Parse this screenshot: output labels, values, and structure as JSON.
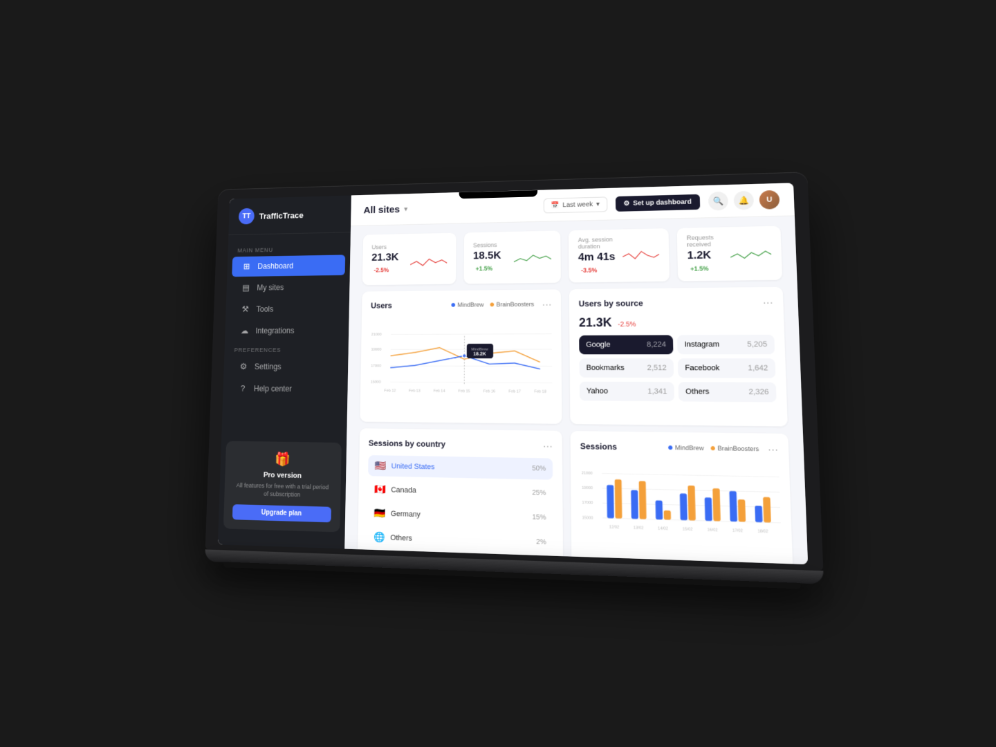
{
  "app": {
    "name": "TrafficTrace"
  },
  "topbar": {
    "title": "All sites",
    "date_filter": "Last week",
    "setup_btn": "Set up dashboard"
  },
  "sidebar": {
    "main_menu_label": "Main menu",
    "preferences_label": "Preferences",
    "items": [
      {
        "id": "dashboard",
        "label": "Dashboard",
        "icon": "⊞",
        "active": true
      },
      {
        "id": "my-sites",
        "label": "My sites",
        "icon": "▤",
        "active": false
      },
      {
        "id": "tools",
        "label": "Tools",
        "icon": "⚒",
        "active": false
      },
      {
        "id": "integrations",
        "label": "Integrations",
        "icon": "☁",
        "active": false
      },
      {
        "id": "settings",
        "label": "Settings",
        "icon": "⚙",
        "active": false
      },
      {
        "id": "help",
        "label": "Help center",
        "icon": "?",
        "active": false
      }
    ],
    "pro": {
      "title": "Pro version",
      "description": "All features for free with a trial period of subscription",
      "upgrade_label": "Upgrade plan"
    }
  },
  "stats": [
    {
      "label": "Users",
      "value": "21.3K",
      "change": "-2.5%",
      "positive": false
    },
    {
      "label": "Sessions",
      "value": "18.5K",
      "change": "+1.5%",
      "positive": true
    },
    {
      "label": "Avg. session duration",
      "value": "4m 41s",
      "change": "-3.5%",
      "positive": false
    },
    {
      "label": "Requests received",
      "value": "1.2K",
      "change": "+1.5%",
      "positive": true
    }
  ],
  "users_chart": {
    "title": "Users",
    "legend": [
      "MindBrew",
      "BrainBoosters"
    ],
    "y_labels": [
      "21000",
      "19000",
      "17000",
      "15000"
    ],
    "x_labels": [
      "Feb 12",
      "Feb 13",
      "Feb 14",
      "Feb 15",
      "Feb 16",
      "Feb 17",
      "Feb 18"
    ],
    "tooltip": {
      "site": "MindBrew",
      "value": "18.2K"
    }
  },
  "users_by_source": {
    "title": "Users by source",
    "total": "21.3K",
    "change": "-2.5%",
    "sources": [
      {
        "name": "Google",
        "count": "8,224",
        "highlighted": true
      },
      {
        "name": "Instagram",
        "count": "5,205",
        "highlighted": false
      },
      {
        "name": "Bookmarks",
        "count": "2,512",
        "highlighted": false
      },
      {
        "name": "Facebook",
        "count": "1,642",
        "highlighted": false
      },
      {
        "name": "Yahoo",
        "count": "1,341",
        "highlighted": false
      },
      {
        "name": "Others",
        "count": "2,326",
        "highlighted": false
      }
    ]
  },
  "sessions_by_country": {
    "title": "Sessions by country",
    "countries": [
      {
        "name": "United States",
        "flag": "🇺🇸",
        "pct": "50%",
        "selected": true
      },
      {
        "name": "Canada",
        "flag": "🇨🇦",
        "pct": "25%",
        "selected": false
      },
      {
        "name": "Germany",
        "flag": "🇩🇪",
        "pct": "15%",
        "selected": false
      },
      {
        "name": "Others",
        "flag": "",
        "pct": "2%",
        "selected": false
      }
    ]
  },
  "sessions_chart": {
    "title": "Sessions",
    "legend": [
      "MindBrew",
      "BrainBoosters"
    ],
    "y_labels": [
      "21000",
      "19000",
      "17000",
      "15000"
    ],
    "x_labels": [
      "12/02",
      "13/02",
      "14/02",
      "15/02",
      "16/02",
      "17/02",
      "18/02"
    ]
  },
  "colors": {
    "primary": "#3a6cf4",
    "accent": "#f4a03a",
    "sidebar_bg": "#1e2025",
    "active_nav": "#3a6cf4",
    "danger": "#e53935",
    "success": "#43a047"
  }
}
